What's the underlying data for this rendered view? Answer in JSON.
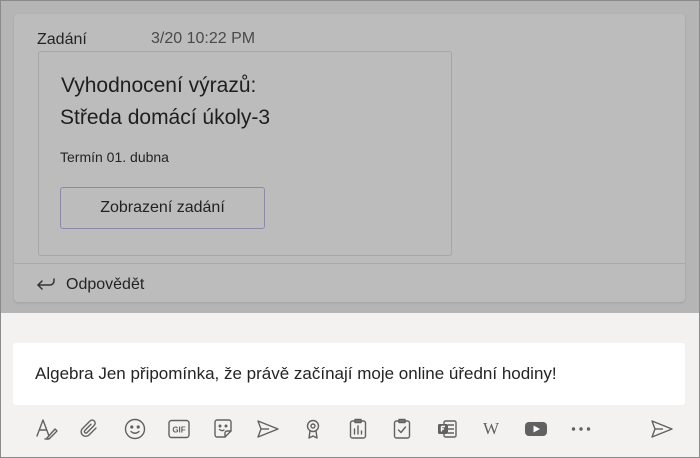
{
  "message": {
    "sender": "Zadání",
    "timestamp": "3/20 10:22 PM",
    "card": {
      "title": "Vyhodnocení výrazů:",
      "subtitle": "Středa domácí úkoly-3",
      "due": "Termín 01. dubna",
      "view_button": "Zobrazení zadání"
    },
    "reply_label": "Odpovědět"
  },
  "compose": {
    "text": "Algebra Jen připomínka, že právě začínají moje online úřední hodiny!",
    "toolbar": [
      {
        "icon": "format-icon"
      },
      {
        "icon": "attach-icon"
      },
      {
        "icon": "emoji-icon"
      },
      {
        "icon": "gif-icon",
        "label": "GIF"
      },
      {
        "icon": "sticker-icon"
      },
      {
        "icon": "meet-now-icon"
      },
      {
        "icon": "praise-icon"
      },
      {
        "icon": "polls-icon"
      },
      {
        "icon": "assignments-icon"
      },
      {
        "icon": "forms-icon"
      },
      {
        "icon": "wikipedia-icon",
        "label": "W"
      },
      {
        "icon": "youtube-icon"
      },
      {
        "icon": "more-options-icon"
      }
    ],
    "send_icon": "send-icon"
  },
  "colors": {
    "icon": "#616161",
    "accent_border": "#8d8aa8",
    "compose_bg": "#f3f2f1"
  }
}
